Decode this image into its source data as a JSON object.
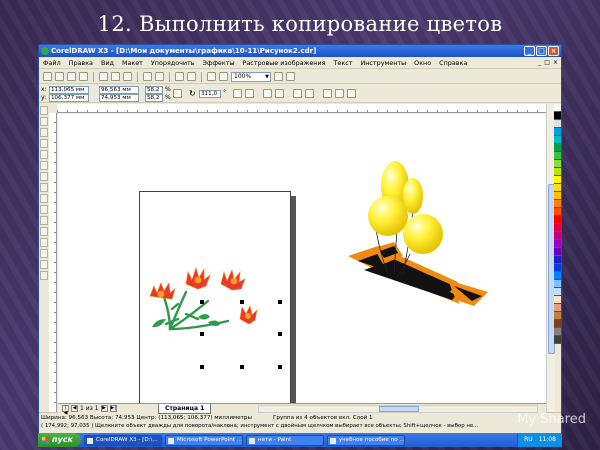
{
  "slide": {
    "title": "12. Выполнить копирование цветов"
  },
  "window": {
    "title": "CorelDRAW X3 - [D:\\Мои документы\\графика\\10-11\\Рисунок2.cdr]"
  },
  "menu": [
    "Файл",
    "Правка",
    "Вид",
    "Макет",
    "Упорядочить",
    "Эффекты",
    "Растровые изображения",
    "Текст",
    "Инструменты",
    "Окно",
    "Справка"
  ],
  "toolbar": {
    "zoom": "100%"
  },
  "props": {
    "x": "113,065 мм",
    "y": "106,377 мм",
    "w": "96,563 мм",
    "h": "74,953 мм",
    "sx": "58,2",
    "sy": "58,2",
    "pct": "%",
    "rotate": "311,0",
    "deg": "°"
  },
  "pagebar": {
    "counter": "1 из 1",
    "tab": "Страница 1"
  },
  "status": {
    "line1": "Ширина: 96,563 Высота: 74,953 Центр: (113,065; 106,377) миллиметры",
    "group": "Группа из 4 объектов вкл. Слой 1",
    "line2": "( 174,992; 97,035 )   Щелкните объект дважды для поворота/наклона; инструмент с двойным щелчком выбирает все объекты; Shift+щелчок - выбор не..."
  },
  "taskbar": {
    "start": "пуск",
    "tasks": [
      "CorelDRAW X3 - [D:\\...",
      "Microsoft PowerPoint ...",
      "нети - Paint",
      "учебное пособие по ..."
    ],
    "lang": "RU",
    "time": "11:08"
  },
  "watermark": "My Shared",
  "palette": [
    "#ffffff",
    "#000000",
    "#e0e0e0",
    "#00a0e0",
    "#00c0c0",
    "#00a050",
    "#40c040",
    "#80e040",
    "#c0e000",
    "#ffff00",
    "#ffe000",
    "#ffc000",
    "#ff8000",
    "#ff5000",
    "#ff0000",
    "#e00040",
    "#c00080",
    "#a000c0",
    "#6000c0",
    "#2020c0",
    "#0040e0",
    "#0080ff",
    "#80c0ff",
    "#c0e0ff",
    "#ffe0c0",
    "#e0a080",
    "#c08040",
    "#804020",
    "#808080",
    "#404040"
  ]
}
